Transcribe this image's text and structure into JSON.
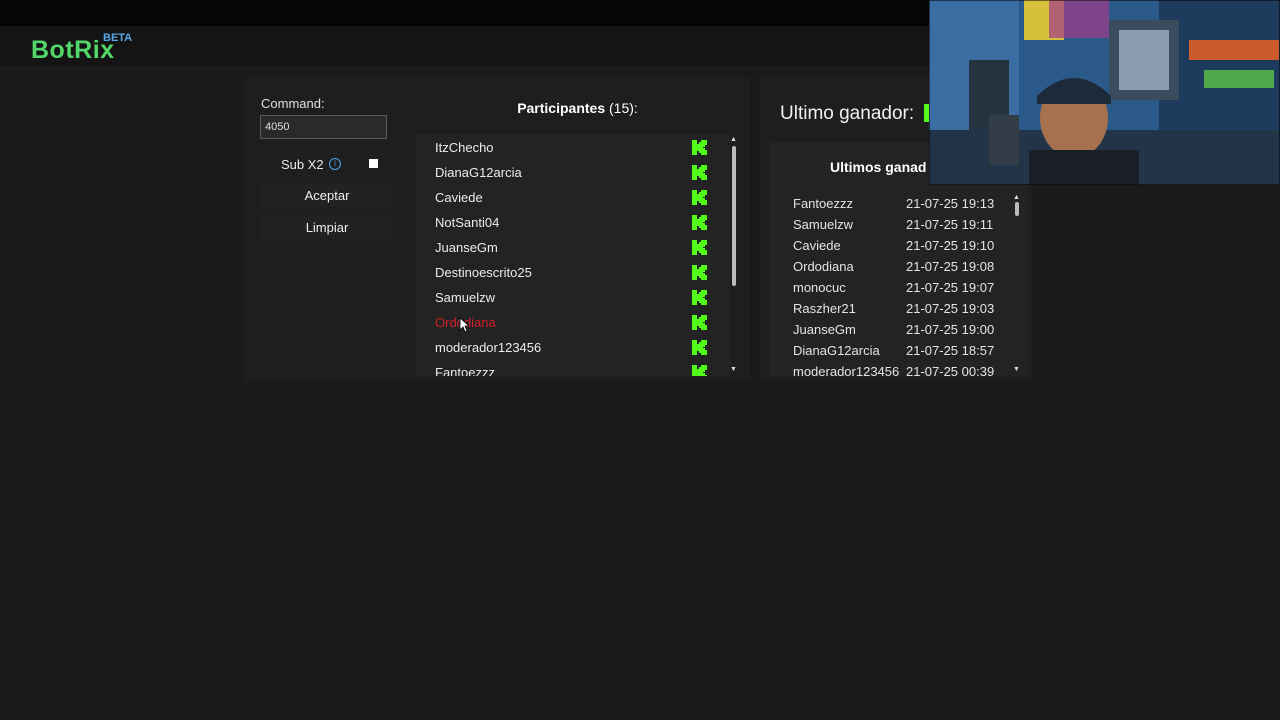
{
  "app": {
    "name": "BotRix",
    "badge": "BETA",
    "brand_color": "#53d769",
    "accent_color": "#53fc18"
  },
  "raffle": {
    "command_label": "Command:",
    "command_value": "4050",
    "sub_label": "Sub X2",
    "sub_checked": false,
    "accept_label": "Aceptar",
    "clear_label": "Limpiar"
  },
  "participants": {
    "title": "Participantes",
    "count": "(15):",
    "items": [
      {
        "name": "ItzChecho",
        "platform_icon": "kick-icon"
      },
      {
        "name": "DianaG12arcia",
        "platform_icon": "kick-icon"
      },
      {
        "name": "Caviede",
        "platform_icon": "kick-icon"
      },
      {
        "name": "NotSanti04",
        "platform_icon": "kick-icon"
      },
      {
        "name": "JuanseGm",
        "platform_icon": "kick-icon"
      },
      {
        "name": "Destinoescrito25",
        "platform_icon": "kick-icon"
      },
      {
        "name": "Samuelzw",
        "platform_icon": "kick-icon"
      },
      {
        "name": "Ordodiana",
        "platform_icon": "kick-icon",
        "highlighted": true
      },
      {
        "name": "moderador123456",
        "platform_icon": "kick-icon"
      },
      {
        "name": "Fantoezzz",
        "platform_icon": "kick-icon"
      }
    ],
    "highlight_color": "#d0202a",
    "scroll_fraction": 0.0
  },
  "winners": {
    "last_winner_label": "Ultimo ganador:",
    "title": "Ultimos ganad",
    "items": [
      {
        "name": "Fantoezzz",
        "date": "21-07-25 19:13"
      },
      {
        "name": "Samuelzw",
        "date": "21-07-25 19:11"
      },
      {
        "name": "Caviede",
        "date": "21-07-25 19:10"
      },
      {
        "name": "Ordodiana",
        "date": "21-07-25 19:08"
      },
      {
        "name": "monocuc",
        "date": "21-07-25 19:07"
      },
      {
        "name": "Raszher21",
        "date": "21-07-25 19:03"
      },
      {
        "name": "JuanseGm",
        "date": "21-07-25 19:00"
      },
      {
        "name": "DianaG12arcia",
        "date": "21-07-25 18:57"
      },
      {
        "name": "moderador123456",
        "date": "21-07-25 00:39"
      }
    ]
  },
  "overlay": {
    "webcam": "webcam-overlay"
  }
}
